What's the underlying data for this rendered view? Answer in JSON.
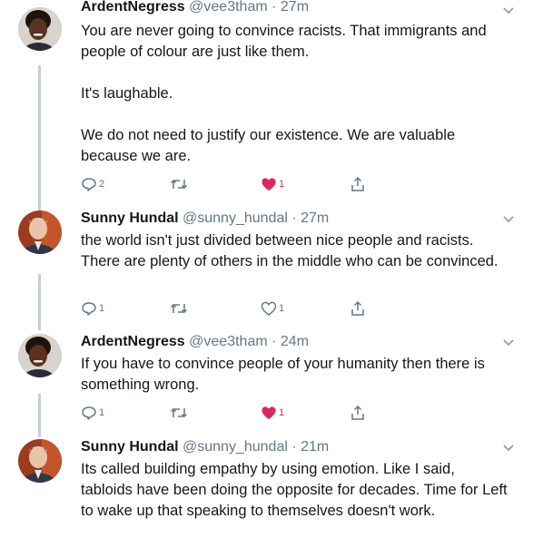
{
  "colors": {
    "text": "#14171a",
    "secondary": "#657786",
    "thread_line": "#c4cfd6",
    "like_active": "#e0245e"
  },
  "tweets": [
    {
      "name": "ArdentNegress",
      "handle": "@vee3tham",
      "time": "27m",
      "text": "You are never going to convince racists. That immigrants and people of colour are just like them.\n\nIt's laughable.\n\nWe do not need to justify our existence. We are valuable because we are.",
      "replies": "2",
      "retweets": "",
      "likes": "1",
      "liked": true,
      "avatar": "woman-avatar"
    },
    {
      "name": "Sunny Hundal",
      "handle": "@sunny_hundal",
      "time": "27m",
      "text": "the world isn't just divided between nice people and racists. There are plenty of others in the middle who can be convinced.",
      "replies": "1",
      "retweets": "",
      "likes": "1",
      "liked": false,
      "avatar": "man-avatar"
    },
    {
      "name": "ArdentNegress",
      "handle": "@vee3tham",
      "time": "24m",
      "text": "If you have to convince people of your humanity then there is something wrong.",
      "replies": "1",
      "retweets": "",
      "likes": "1",
      "liked": true,
      "avatar": "woman-avatar"
    },
    {
      "name": "Sunny Hundal",
      "handle": "@sunny_hundal",
      "time": "21m",
      "text": "Its called building empathy by using emotion. Like I said, tabloids have been doing the opposite for decades. Time for Left to wake up that speaking to themselves doesn't work.",
      "replies": "",
      "retweets": "",
      "likes": "",
      "liked": false,
      "avatar": "man-avatar"
    }
  ]
}
